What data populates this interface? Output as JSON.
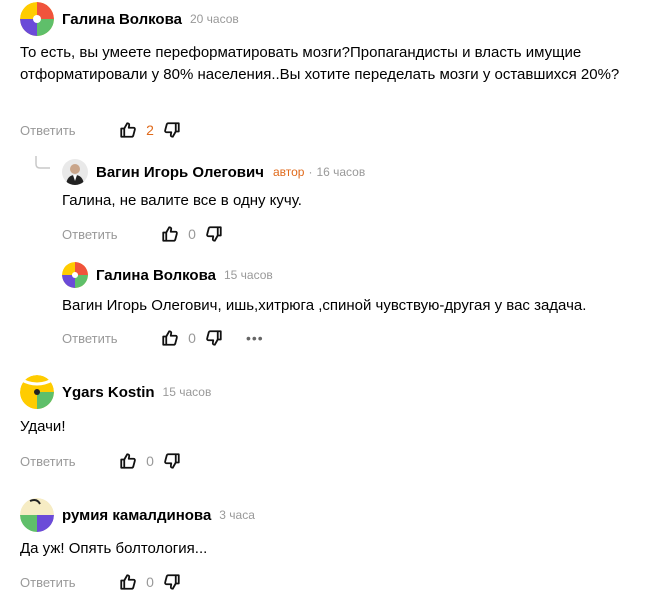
{
  "comments": [
    {
      "author": "Галина Волкова",
      "time": "20 часов",
      "text": "То есть, вы умеете переформатировать мозги?Пропагандисты и власть имущие отформатировали у 80% населения..Вы хотите переделать мозги у оставшихся 20%?",
      "reply_label": "Ответить",
      "likes": "2"
    },
    {
      "author": "Вагин Игорь Олегович",
      "author_badge": "автор",
      "separator": "·",
      "time": "16 часов",
      "text": "Галина, не валите все в одну кучу.",
      "reply_label": "Ответить",
      "likes": "0"
    },
    {
      "author": "Галина Волкова",
      "time": "15 часов",
      "text": "Вагин Игорь Олегович, ишь,хитрюга ,спиной чувствую-другая у вас задача.",
      "reply_label": "Ответить",
      "likes": "0",
      "more_label": "•••"
    },
    {
      "author": "Ygars Kostin",
      "time": "15 часов",
      "text": "Удачи!",
      "reply_label": "Ответить",
      "likes": "0"
    },
    {
      "author": "румия камалдинова",
      "time": "3 часа",
      "text": "Да уж! Опять болтология...",
      "reply_label": "Ответить",
      "likes": "0"
    }
  ],
  "colors": {
    "author_badge": "#e06a1b",
    "muted": "#999999",
    "avatar_yellow": "#ffcc00",
    "avatar_red": "#f0533c",
    "avatar_purple": "#6b4bd8",
    "avatar_green": "#5fbf6a"
  },
  "icons": [
    "like-icon",
    "dislike-icon",
    "more-icon",
    "thread-connector-icon"
  ]
}
